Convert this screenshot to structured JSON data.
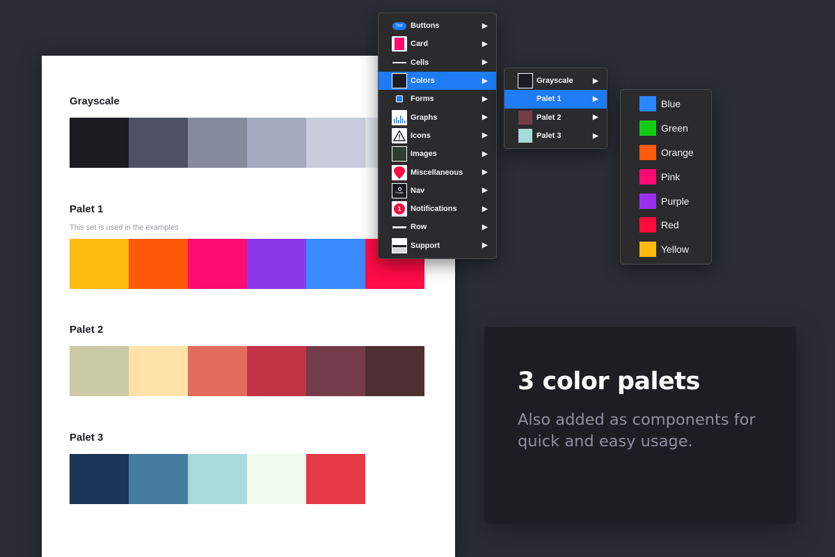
{
  "document": {
    "sections": [
      {
        "title": "Grayscale",
        "subtitle": "",
        "colors": [
          "#1b1c21",
          "#4e5164",
          "#858a9d",
          "#a4a9c0",
          "#c8ccdd",
          "#e2e4ee"
        ]
      },
      {
        "title": "Palet 1",
        "subtitle": "This set is used in the examples",
        "colors": [
          "#ffba0e",
          "#ff5a0c",
          "#ff0b74",
          "#8b38ea",
          "#3a8bff",
          "#ff0b45"
        ]
      },
      {
        "title": "Palet 2",
        "subtitle": "",
        "colors": [
          "#cacba6",
          "#fee2a9",
          "#e26c5c",
          "#c13446",
          "#743b4b",
          "#4d2e33"
        ]
      },
      {
        "title": "Palet 3",
        "subtitle": "",
        "colors": [
          "#1e355a",
          "#457b9d",
          "#a8dadc",
          "#f1faee",
          "#e63a47"
        ]
      }
    ]
  },
  "main_menu": {
    "items": [
      {
        "label": "Buttons",
        "icon": "button-icon",
        "badge": "Text"
      },
      {
        "label": "Card",
        "icon": "card-icon"
      },
      {
        "label": "Cells",
        "icon": "cells-icon"
      },
      {
        "label": "Colors",
        "icon": "colors-icon",
        "active": true
      },
      {
        "label": "Forms",
        "icon": "forms-icon"
      },
      {
        "label": "Graphs",
        "icon": "graphs-icon"
      },
      {
        "label": "Icons",
        "icon": "warning-icon"
      },
      {
        "label": "Images",
        "icon": "images-icon"
      },
      {
        "label": "Miscellaneous",
        "icon": "map-pin-icon"
      },
      {
        "label": "Nav",
        "icon": "nav-icon",
        "badge": "Profile"
      },
      {
        "label": "Notifications",
        "icon": "notification-icon",
        "badge": "1"
      },
      {
        "label": "Row",
        "icon": "row-icon"
      },
      {
        "label": "Support",
        "icon": "support-icon"
      }
    ],
    "arrow": "▶"
  },
  "colors_menu": {
    "items": [
      {
        "label": "Grayscale",
        "color": "#1b1c21"
      },
      {
        "label": "Palet 1",
        "color": "#1e7cf5",
        "active": true
      },
      {
        "label": "Palet 2",
        "color": "#743b4b"
      },
      {
        "label": "Palet 3",
        "color": "#a8dadc"
      }
    ]
  },
  "palet1_menu": {
    "items": [
      {
        "label": "Blue",
        "color": "#2a87ff"
      },
      {
        "label": "Green",
        "color": "#12cc16"
      },
      {
        "label": "Orange",
        "color": "#ff5a0c"
      },
      {
        "label": "Pink",
        "color": "#ff0b74"
      },
      {
        "label": "Purple",
        "color": "#9a2ff0"
      },
      {
        "label": "Red",
        "color": "#ff0b3a"
      },
      {
        "label": "Yellow",
        "color": "#ffba0e"
      }
    ]
  },
  "promo": {
    "title": "3 color palets",
    "body": "Also added as components for quick and easy usage."
  }
}
